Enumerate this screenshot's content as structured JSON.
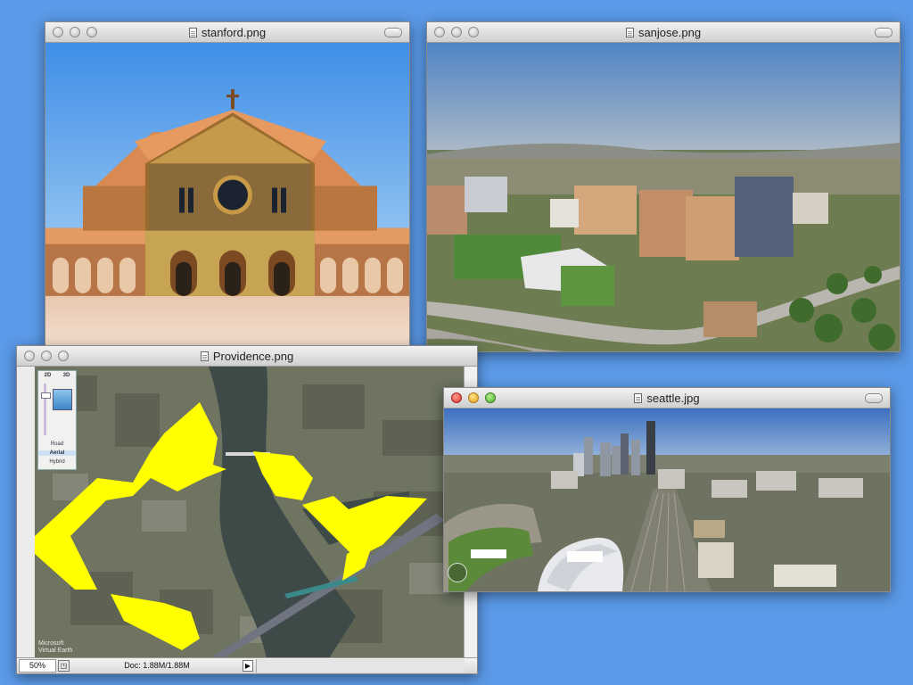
{
  "desktop": {
    "background": "#5b9ae8"
  },
  "windows": {
    "stanford": {
      "title": "stanford.png"
    },
    "sanjose": {
      "title": "sanjose.png"
    },
    "providence": {
      "title": "Providence.png",
      "map_controls": {
        "tab_2d": "2D",
        "tab_3d": "3D",
        "road": "Road",
        "aerial": "Aerial",
        "hybrid": "Hybrid"
      },
      "logo_line1": "Microsoft",
      "logo_line2": "Virtual Earth",
      "status": {
        "zoom": "50%",
        "doc": "Doc: 1.88M/1.88M"
      },
      "highlight_color": "#ffff00"
    },
    "seattle": {
      "title": "seattle.jpg"
    }
  }
}
